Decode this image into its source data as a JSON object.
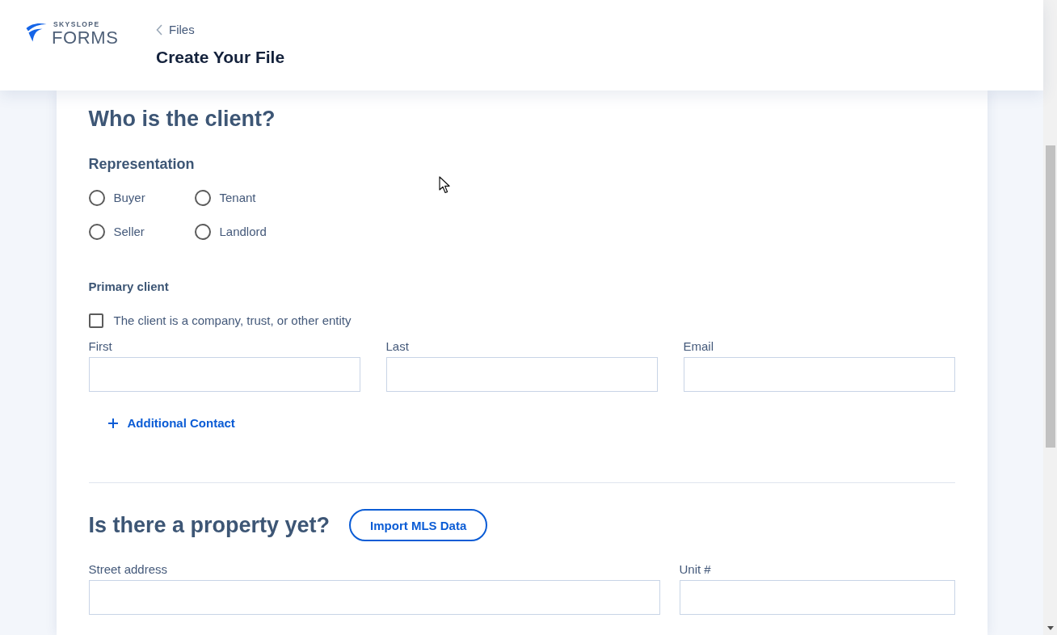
{
  "header": {
    "logo": {
      "brand": "SKYSLOPE",
      "product": "FORMS"
    },
    "back_link": {
      "label": "Files"
    },
    "title": "Create Your File"
  },
  "client_section": {
    "heading": "Who is the client?",
    "representation": {
      "label": "Representation",
      "options": [
        {
          "label": "Buyer",
          "selected": false
        },
        {
          "label": "Tenant",
          "selected": false
        },
        {
          "label": "Seller",
          "selected": false
        },
        {
          "label": "Landlord",
          "selected": false
        }
      ]
    },
    "primary_client": {
      "label": "Primary client",
      "entity_checkbox": {
        "label": "The client is a company, trust, or other entity",
        "checked": false
      },
      "fields": [
        {
          "label": "First"
        },
        {
          "label": "Last"
        },
        {
          "label": "Email"
        }
      ]
    },
    "add_contact_button": "Additional Contact"
  },
  "property_section": {
    "heading": "Is there a property yet?",
    "import_button": "Import MLS Data",
    "fields": [
      {
        "label": "Street address"
      },
      {
        "label": "Unit #"
      }
    ]
  }
}
